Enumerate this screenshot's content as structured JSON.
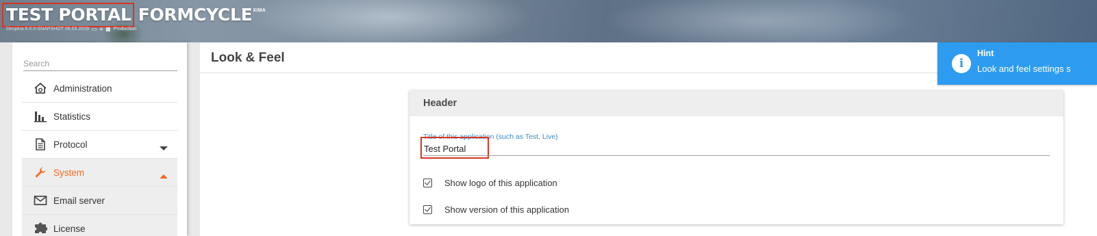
{
  "header": {
    "app_title": "TEST PORTAL",
    "brand": "FORMCYCLE",
    "brand_sup": "XIMA",
    "build_info": "Despina 6.0.0-SNAPSHOT 06.03.2019",
    "environment": "Production"
  },
  "sidebar": {
    "search_placeholder": "Search",
    "items": [
      {
        "label": "Administration",
        "icon": "admin-house-icon"
      },
      {
        "label": "Statistics",
        "icon": "bar-chart-icon"
      },
      {
        "label": "Protocol",
        "icon": "document-icon",
        "expanded": false
      },
      {
        "label": "System",
        "icon": "wrench-icon",
        "expanded": true,
        "active": true
      }
    ],
    "sub_items": [
      {
        "label": "Email server",
        "icon": "envelope-icon"
      },
      {
        "label": "License",
        "icon": "puzzle-icon"
      }
    ]
  },
  "main": {
    "page_title": "Look & Feel",
    "card": {
      "header": "Header",
      "field_label": "Title of this application (such as Test, Live)",
      "field_value": "Test Portal",
      "checkboxes": [
        {
          "label": "Show logo of this application",
          "checked": true
        },
        {
          "label": "Show version of this application",
          "checked": true
        }
      ]
    }
  },
  "hint": {
    "title": "Hint",
    "text": "Look and feel settings s"
  },
  "colors": {
    "accent": "#f36b21",
    "hint_bg": "#2d9cf0",
    "highlight_box": "#d9341f",
    "field_label": "#3b8bc4"
  }
}
